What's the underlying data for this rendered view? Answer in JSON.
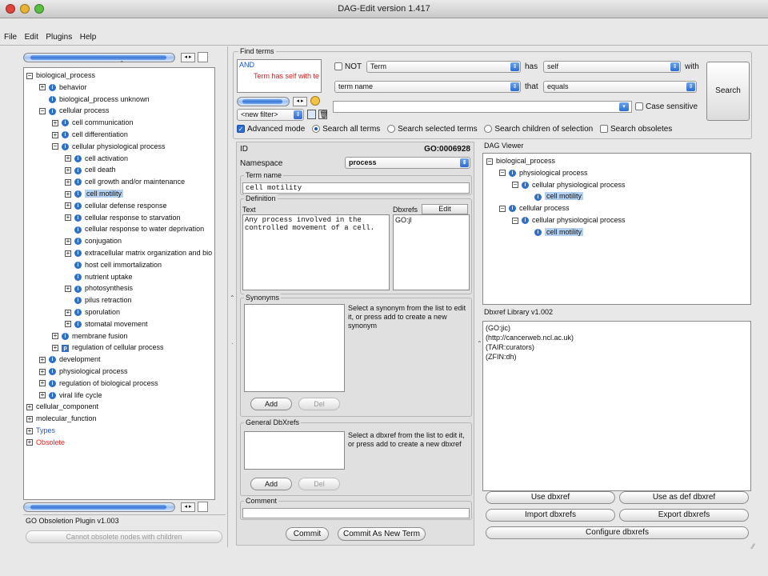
{
  "window": {
    "title": "DAG-Edit version 1.417"
  },
  "menu": [
    "File",
    "Edit",
    "Plugins",
    "Help"
  ],
  "tree": {
    "rows": [
      {
        "label": "biological_process",
        "level": 0,
        "expander": "minus",
        "icon": "none"
      },
      {
        "label": "behavior",
        "level": 1,
        "expander": "plus",
        "icon": "circle"
      },
      {
        "label": "biological_process unknown",
        "level": 1,
        "expander": "none",
        "icon": "circle"
      },
      {
        "label": "cellular process",
        "level": 1,
        "expander": "minus",
        "icon": "circle"
      },
      {
        "label": "cell communication",
        "level": 2,
        "expander": "plus",
        "icon": "circle"
      },
      {
        "label": "cell differentiation",
        "level": 2,
        "expander": "plus",
        "icon": "circle"
      },
      {
        "label": "cellular physiological process",
        "level": 2,
        "expander": "minus",
        "icon": "circle"
      },
      {
        "label": "cell activation",
        "level": 3,
        "expander": "plus",
        "icon": "circle"
      },
      {
        "label": "cell death",
        "level": 3,
        "expander": "plus",
        "icon": "circle"
      },
      {
        "label": "cell growth and/or maintenance",
        "level": 3,
        "expander": "plus",
        "icon": "circle"
      },
      {
        "label": "cell motility",
        "level": 3,
        "expander": "plus",
        "icon": "circle",
        "selected": true
      },
      {
        "label": "cellular defense response",
        "level": 3,
        "expander": "plus",
        "icon": "circle"
      },
      {
        "label": "cellular response to starvation",
        "level": 3,
        "expander": "plus",
        "icon": "circle"
      },
      {
        "label": "cellular response to water deprivation",
        "level": 3,
        "expander": "none",
        "icon": "circle"
      },
      {
        "label": "conjugation",
        "level": 3,
        "expander": "plus",
        "icon": "circle"
      },
      {
        "label": "extracellular matrix organization and bio",
        "level": 3,
        "expander": "plus",
        "icon": "circle"
      },
      {
        "label": "host cell immortalization",
        "level": 3,
        "expander": "none",
        "icon": "circle"
      },
      {
        "label": "nutrient uptake",
        "level": 3,
        "expander": "none",
        "icon": "circle"
      },
      {
        "label": "photosynthesis",
        "level": 3,
        "expander": "plus",
        "icon": "circle"
      },
      {
        "label": "pilus retraction",
        "level": 3,
        "expander": "none",
        "icon": "circle"
      },
      {
        "label": "sporulation",
        "level": 3,
        "expander": "plus",
        "icon": "circle"
      },
      {
        "label": "stomatal movement",
        "level": 3,
        "expander": "plus",
        "icon": "circle"
      },
      {
        "label": "membrane fusion",
        "level": 2,
        "expander": "plus",
        "icon": "circle"
      },
      {
        "label": "regulation of cellular process",
        "level": 2,
        "expander": "plus",
        "icon": "square"
      },
      {
        "label": "development",
        "level": 1,
        "expander": "plus",
        "icon": "circle"
      },
      {
        "label": "physiological process",
        "level": 1,
        "expander": "plus",
        "icon": "circle"
      },
      {
        "label": "regulation of biological process",
        "level": 1,
        "expander": "plus",
        "icon": "circle"
      },
      {
        "label": "viral life cycle",
        "level": 1,
        "expander": "plus",
        "icon": "circle"
      },
      {
        "label": "cellular_component",
        "level": 0,
        "expander": "plus",
        "icon": "none"
      },
      {
        "label": "molecular_function",
        "level": 0,
        "expander": "plus",
        "icon": "none"
      },
      {
        "label": "Types",
        "level": 0,
        "expander": "plus",
        "icon": "none",
        "color": "#2255cc"
      },
      {
        "label": "Obsolete",
        "level": 0,
        "expander": "plus",
        "icon": "none",
        "color": "#dd2222"
      }
    ]
  },
  "obsolete_plugin": {
    "title": "GO Obsoletion Plugin v1.003",
    "button": "Cannot obsolete nodes with children"
  },
  "find": {
    "group_label": "Find terms",
    "and_label": "AND",
    "filter_item": "Term has self with te",
    "not_label": "NOT",
    "term_select": "Term",
    "has_label": "has",
    "self_select": "self",
    "with_label": "with",
    "term_name_select": "term name",
    "that_label": "that",
    "equals_select": "equals",
    "new_filter_select": "<new filter>",
    "search_value": "",
    "case_sensitive": "Case sensitive",
    "search_button": "Search",
    "advanced_mode": "Advanced mode",
    "search_all": "Search all terms",
    "search_selected": "Search selected terms",
    "search_children": "Search children of selection",
    "search_obsoletes": "Search obsoletes"
  },
  "term": {
    "id_label": "ID",
    "id_value": "GO:0006928",
    "namespace_label": "Namespace",
    "namespace_value": "process",
    "term_name_label": "Term name",
    "term_name_value": "cell motility",
    "definition_label": "Definition",
    "text_label": "Text",
    "definition_text": "Any process involved in the controlled movement of a cell.",
    "dbxrefs_label": "Dbxrefs",
    "edit_button": "Edit",
    "def_dbxref": "GO:jl",
    "synonyms_label": "Synonyms",
    "synonyms_help": "Select a synonym from the list to edit it, or press add to create a new synonym",
    "add_button": "Add",
    "del_button": "Del",
    "general_dbxrefs_label": "General DbXrefs",
    "general_dbxrefs_help": "Select a dbxref from the list to edit it, or press add to create a new dbxref",
    "comment_label": "Comment",
    "commit_button": "Commit",
    "commit_new_button": "Commit As New Term"
  },
  "dag": {
    "label": "DAG Viewer",
    "rows": [
      {
        "label": "biological_process",
        "level": 0,
        "expander": "minus",
        "icon": "none"
      },
      {
        "label": "physiological process",
        "level": 1,
        "expander": "minus",
        "icon": "circle"
      },
      {
        "label": "cellular physiological process",
        "level": 2,
        "expander": "minus",
        "icon": "circle"
      },
      {
        "label": "cell motility",
        "level": 3,
        "expander": "none",
        "icon": "circle",
        "selected": true
      },
      {
        "label": "cellular process",
        "level": 1,
        "expander": "minus",
        "icon": "circle"
      },
      {
        "label": "cellular physiological process",
        "level": 2,
        "expander": "minus",
        "icon": "circle"
      },
      {
        "label": "cell motility",
        "level": 3,
        "expander": "none",
        "icon": "circle",
        "selected": true
      }
    ]
  },
  "dbxref_lib": {
    "label": "Dbxref Library v1.002",
    "items": [
      "(GO:jic)",
      "(http://cancerweb.ncl.ac.uk)",
      "(TAIR:curators)",
      "(ZFIN:dh)"
    ],
    "use_dbxref": "Use dbxref",
    "use_as_def": "Use as def dbxref",
    "import": "Import dbxrefs",
    "export": "Export dbxrefs",
    "configure": "Configure dbxrefs"
  }
}
